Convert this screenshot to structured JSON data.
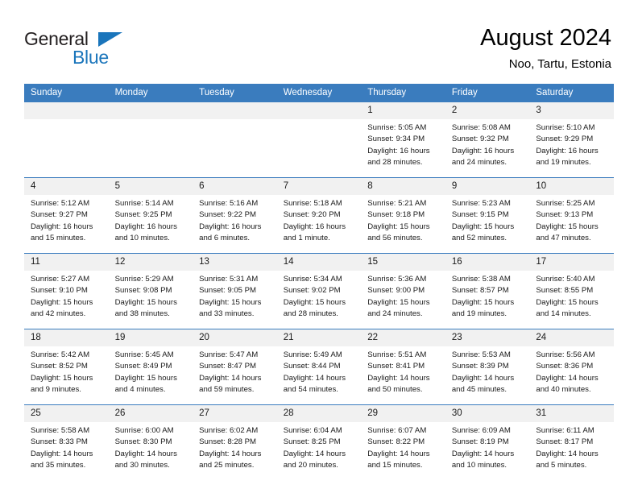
{
  "logo": {
    "word1": "General",
    "word2": "Blue",
    "triangle_color": "#1a75bb",
    "text_color": "#231f20"
  },
  "header": {
    "title": "August 2024",
    "subtitle": "Noo, Tartu, Estonia"
  },
  "theme": {
    "header_bg": "#3a7cbe",
    "header_text": "#ffffff",
    "daynum_bg": "#f1f1f1",
    "grid_line": "#3a7cbe"
  },
  "weekdays": [
    "Sunday",
    "Monday",
    "Tuesday",
    "Wednesday",
    "Thursday",
    "Friday",
    "Saturday"
  ],
  "weeks": [
    [
      {
        "day": "",
        "sunrise": "",
        "sunset": "",
        "daylight_l1": "",
        "daylight_l2": ""
      },
      {
        "day": "",
        "sunrise": "",
        "sunset": "",
        "daylight_l1": "",
        "daylight_l2": ""
      },
      {
        "day": "",
        "sunrise": "",
        "sunset": "",
        "daylight_l1": "",
        "daylight_l2": ""
      },
      {
        "day": "",
        "sunrise": "",
        "sunset": "",
        "daylight_l1": "",
        "daylight_l2": ""
      },
      {
        "day": "1",
        "sunrise": "Sunrise: 5:05 AM",
        "sunset": "Sunset: 9:34 PM",
        "daylight_l1": "Daylight: 16 hours",
        "daylight_l2": "and 28 minutes."
      },
      {
        "day": "2",
        "sunrise": "Sunrise: 5:08 AM",
        "sunset": "Sunset: 9:32 PM",
        "daylight_l1": "Daylight: 16 hours",
        "daylight_l2": "and 24 minutes."
      },
      {
        "day": "3",
        "sunrise": "Sunrise: 5:10 AM",
        "sunset": "Sunset: 9:29 PM",
        "daylight_l1": "Daylight: 16 hours",
        "daylight_l2": "and 19 minutes."
      }
    ],
    [
      {
        "day": "4",
        "sunrise": "Sunrise: 5:12 AM",
        "sunset": "Sunset: 9:27 PM",
        "daylight_l1": "Daylight: 16 hours",
        "daylight_l2": "and 15 minutes."
      },
      {
        "day": "5",
        "sunrise": "Sunrise: 5:14 AM",
        "sunset": "Sunset: 9:25 PM",
        "daylight_l1": "Daylight: 16 hours",
        "daylight_l2": "and 10 minutes."
      },
      {
        "day": "6",
        "sunrise": "Sunrise: 5:16 AM",
        "sunset": "Sunset: 9:22 PM",
        "daylight_l1": "Daylight: 16 hours",
        "daylight_l2": "and 6 minutes."
      },
      {
        "day": "7",
        "sunrise": "Sunrise: 5:18 AM",
        "sunset": "Sunset: 9:20 PM",
        "daylight_l1": "Daylight: 16 hours",
        "daylight_l2": "and 1 minute."
      },
      {
        "day": "8",
        "sunrise": "Sunrise: 5:21 AM",
        "sunset": "Sunset: 9:18 PM",
        "daylight_l1": "Daylight: 15 hours",
        "daylight_l2": "and 56 minutes."
      },
      {
        "day": "9",
        "sunrise": "Sunrise: 5:23 AM",
        "sunset": "Sunset: 9:15 PM",
        "daylight_l1": "Daylight: 15 hours",
        "daylight_l2": "and 52 minutes."
      },
      {
        "day": "10",
        "sunrise": "Sunrise: 5:25 AM",
        "sunset": "Sunset: 9:13 PM",
        "daylight_l1": "Daylight: 15 hours",
        "daylight_l2": "and 47 minutes."
      }
    ],
    [
      {
        "day": "11",
        "sunrise": "Sunrise: 5:27 AM",
        "sunset": "Sunset: 9:10 PM",
        "daylight_l1": "Daylight: 15 hours",
        "daylight_l2": "and 42 minutes."
      },
      {
        "day": "12",
        "sunrise": "Sunrise: 5:29 AM",
        "sunset": "Sunset: 9:08 PM",
        "daylight_l1": "Daylight: 15 hours",
        "daylight_l2": "and 38 minutes."
      },
      {
        "day": "13",
        "sunrise": "Sunrise: 5:31 AM",
        "sunset": "Sunset: 9:05 PM",
        "daylight_l1": "Daylight: 15 hours",
        "daylight_l2": "and 33 minutes."
      },
      {
        "day": "14",
        "sunrise": "Sunrise: 5:34 AM",
        "sunset": "Sunset: 9:02 PM",
        "daylight_l1": "Daylight: 15 hours",
        "daylight_l2": "and 28 minutes."
      },
      {
        "day": "15",
        "sunrise": "Sunrise: 5:36 AM",
        "sunset": "Sunset: 9:00 PM",
        "daylight_l1": "Daylight: 15 hours",
        "daylight_l2": "and 24 minutes."
      },
      {
        "day": "16",
        "sunrise": "Sunrise: 5:38 AM",
        "sunset": "Sunset: 8:57 PM",
        "daylight_l1": "Daylight: 15 hours",
        "daylight_l2": "and 19 minutes."
      },
      {
        "day": "17",
        "sunrise": "Sunrise: 5:40 AM",
        "sunset": "Sunset: 8:55 PM",
        "daylight_l1": "Daylight: 15 hours",
        "daylight_l2": "and 14 minutes."
      }
    ],
    [
      {
        "day": "18",
        "sunrise": "Sunrise: 5:42 AM",
        "sunset": "Sunset: 8:52 PM",
        "daylight_l1": "Daylight: 15 hours",
        "daylight_l2": "and 9 minutes."
      },
      {
        "day": "19",
        "sunrise": "Sunrise: 5:45 AM",
        "sunset": "Sunset: 8:49 PM",
        "daylight_l1": "Daylight: 15 hours",
        "daylight_l2": "and 4 minutes."
      },
      {
        "day": "20",
        "sunrise": "Sunrise: 5:47 AM",
        "sunset": "Sunset: 8:47 PM",
        "daylight_l1": "Daylight: 14 hours",
        "daylight_l2": "and 59 minutes."
      },
      {
        "day": "21",
        "sunrise": "Sunrise: 5:49 AM",
        "sunset": "Sunset: 8:44 PM",
        "daylight_l1": "Daylight: 14 hours",
        "daylight_l2": "and 54 minutes."
      },
      {
        "day": "22",
        "sunrise": "Sunrise: 5:51 AM",
        "sunset": "Sunset: 8:41 PM",
        "daylight_l1": "Daylight: 14 hours",
        "daylight_l2": "and 50 minutes."
      },
      {
        "day": "23",
        "sunrise": "Sunrise: 5:53 AM",
        "sunset": "Sunset: 8:39 PM",
        "daylight_l1": "Daylight: 14 hours",
        "daylight_l2": "and 45 minutes."
      },
      {
        "day": "24",
        "sunrise": "Sunrise: 5:56 AM",
        "sunset": "Sunset: 8:36 PM",
        "daylight_l1": "Daylight: 14 hours",
        "daylight_l2": "and 40 minutes."
      }
    ],
    [
      {
        "day": "25",
        "sunrise": "Sunrise: 5:58 AM",
        "sunset": "Sunset: 8:33 PM",
        "daylight_l1": "Daylight: 14 hours",
        "daylight_l2": "and 35 minutes."
      },
      {
        "day": "26",
        "sunrise": "Sunrise: 6:00 AM",
        "sunset": "Sunset: 8:30 PM",
        "daylight_l1": "Daylight: 14 hours",
        "daylight_l2": "and 30 minutes."
      },
      {
        "day": "27",
        "sunrise": "Sunrise: 6:02 AM",
        "sunset": "Sunset: 8:28 PM",
        "daylight_l1": "Daylight: 14 hours",
        "daylight_l2": "and 25 minutes."
      },
      {
        "day": "28",
        "sunrise": "Sunrise: 6:04 AM",
        "sunset": "Sunset: 8:25 PM",
        "daylight_l1": "Daylight: 14 hours",
        "daylight_l2": "and 20 minutes."
      },
      {
        "day": "29",
        "sunrise": "Sunrise: 6:07 AM",
        "sunset": "Sunset: 8:22 PM",
        "daylight_l1": "Daylight: 14 hours",
        "daylight_l2": "and 15 minutes."
      },
      {
        "day": "30",
        "sunrise": "Sunrise: 6:09 AM",
        "sunset": "Sunset: 8:19 PM",
        "daylight_l1": "Daylight: 14 hours",
        "daylight_l2": "and 10 minutes."
      },
      {
        "day": "31",
        "sunrise": "Sunrise: 6:11 AM",
        "sunset": "Sunset: 8:17 PM",
        "daylight_l1": "Daylight: 14 hours",
        "daylight_l2": "and 5 minutes."
      }
    ]
  ]
}
